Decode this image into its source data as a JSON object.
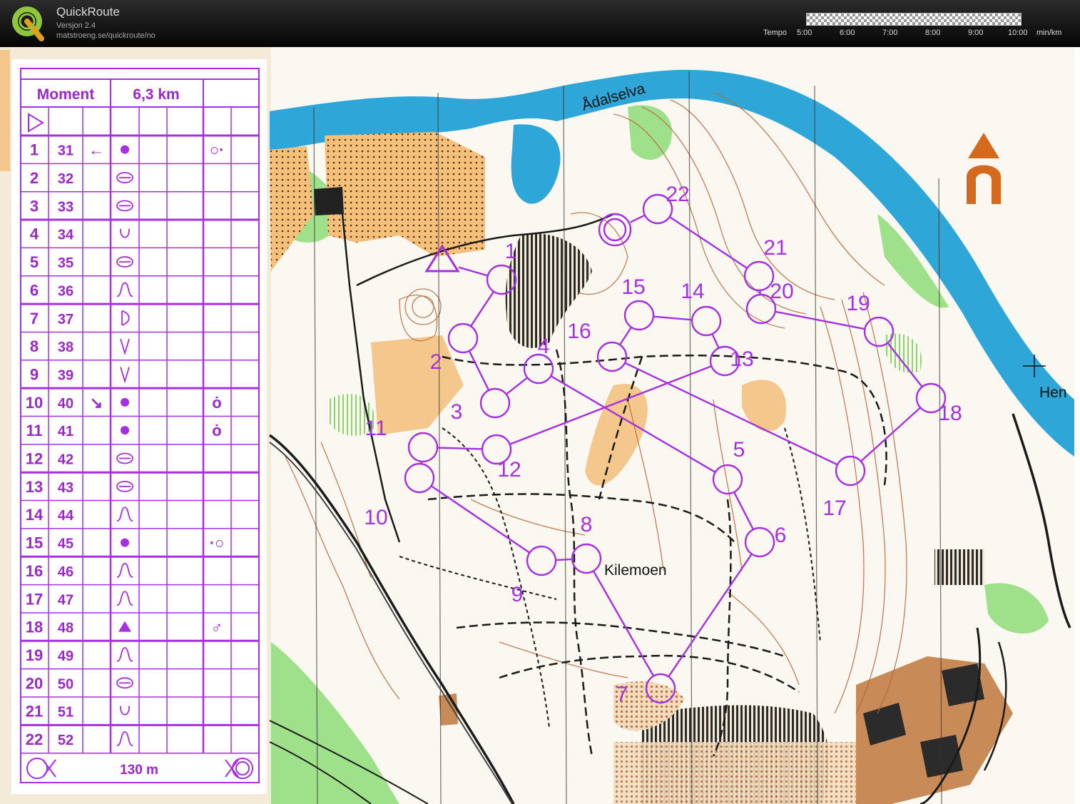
{
  "app": {
    "title": "QuickRoute",
    "version": "Versjon 2.4",
    "url": "matstroeng.se/quickroute/no"
  },
  "pace_legend": {
    "label": "Tempo",
    "ticks": [
      "5:00",
      "6:00",
      "7:00",
      "8:00",
      "9:00",
      "10:00"
    ],
    "unit": "min/km"
  },
  "map": {
    "labels": {
      "river": "Ådalselva",
      "place": "Kilemoen",
      "edge_place": "Hen"
    },
    "course_color": "#a530e0",
    "start_label": "",
    "controls": [
      {
        "n": "1",
        "label": "1"
      },
      {
        "n": "2",
        "label": "2"
      },
      {
        "n": "3",
        "label": "3"
      },
      {
        "n": "4",
        "label": "4"
      },
      {
        "n": "5",
        "label": "5"
      },
      {
        "n": "6",
        "label": "6"
      },
      {
        "n": "7",
        "label": "7"
      },
      {
        "n": "8",
        "label": "8"
      },
      {
        "n": "9",
        "label": "9"
      },
      {
        "n": "10",
        "label": "10"
      },
      {
        "n": "11",
        "label": "11"
      },
      {
        "n": "12",
        "label": "12"
      },
      {
        "n": "13",
        "label": "13"
      },
      {
        "n": "14",
        "label": "14"
      },
      {
        "n": "15",
        "label": "15"
      },
      {
        "n": "16",
        "label": "16"
      },
      {
        "n": "17",
        "label": "17"
      },
      {
        "n": "18",
        "label": "18"
      },
      {
        "n": "19",
        "label": "19"
      },
      {
        "n": "20",
        "label": "20"
      },
      {
        "n": "21",
        "label": "21"
      },
      {
        "n": "22",
        "label": "22"
      }
    ]
  },
  "description_sheet": {
    "event": "Moment",
    "length": "6,3 km",
    "finish_distance": "130 m",
    "rows": [
      {
        "n": "1",
        "code": "31",
        "dir": "←",
        "sym": "dot",
        "extra": "○·"
      },
      {
        "n": "2",
        "code": "32",
        "dir": "",
        "sym": "ellipse",
        "extra": ""
      },
      {
        "n": "3",
        "code": "33",
        "dir": "",
        "sym": "ellipse",
        "extra": ""
      },
      {
        "n": "4",
        "code": "34",
        "dir": "",
        "sym": "cup",
        "extra": ""
      },
      {
        "n": "5",
        "code": "35",
        "dir": "",
        "sym": "ellipse",
        "extra": ""
      },
      {
        "n": "6",
        "code": "36",
        "dir": "",
        "sym": "knoll",
        "extra": ""
      },
      {
        "n": "7",
        "code": "37",
        "dir": "",
        "sym": "cliff",
        "extra": ""
      },
      {
        "n": "8",
        "code": "38",
        "dir": "",
        "sym": "vee",
        "extra": ""
      },
      {
        "n": "9",
        "code": "39",
        "dir": "",
        "sym": "vee",
        "extra": ""
      },
      {
        "n": "10",
        "code": "40",
        "dir": "↘",
        "sym": "dot",
        "extra": "ȯ"
      },
      {
        "n": "11",
        "code": "41",
        "dir": "",
        "sym": "dot",
        "extra": "ȯ"
      },
      {
        "n": "12",
        "code": "42",
        "dir": "",
        "sym": "ellipse",
        "extra": ""
      },
      {
        "n": "13",
        "code": "43",
        "dir": "",
        "sym": "ellipse",
        "extra": ""
      },
      {
        "n": "14",
        "code": "44",
        "dir": "",
        "sym": "knoll",
        "extra": ""
      },
      {
        "n": "15",
        "code": "45",
        "dir": "",
        "sym": "dot",
        "extra": "·○"
      },
      {
        "n": "16",
        "code": "46",
        "dir": "",
        "sym": "knoll",
        "extra": ""
      },
      {
        "n": "17",
        "code": "47",
        "dir": "",
        "sym": "knoll",
        "extra": ""
      },
      {
        "n": "18",
        "code": "48",
        "dir": "",
        "sym": "triangle",
        "extra": "♂"
      },
      {
        "n": "19",
        "code": "49",
        "dir": "",
        "sym": "knoll",
        "extra": ""
      },
      {
        "n": "20",
        "code": "50",
        "dir": "",
        "sym": "ellipse",
        "extra": ""
      },
      {
        "n": "21",
        "code": "51",
        "dir": "",
        "sym": "cup",
        "extra": ""
      },
      {
        "n": "22",
        "code": "52",
        "dir": "",
        "sym": "knoll",
        "extra": ""
      }
    ]
  }
}
